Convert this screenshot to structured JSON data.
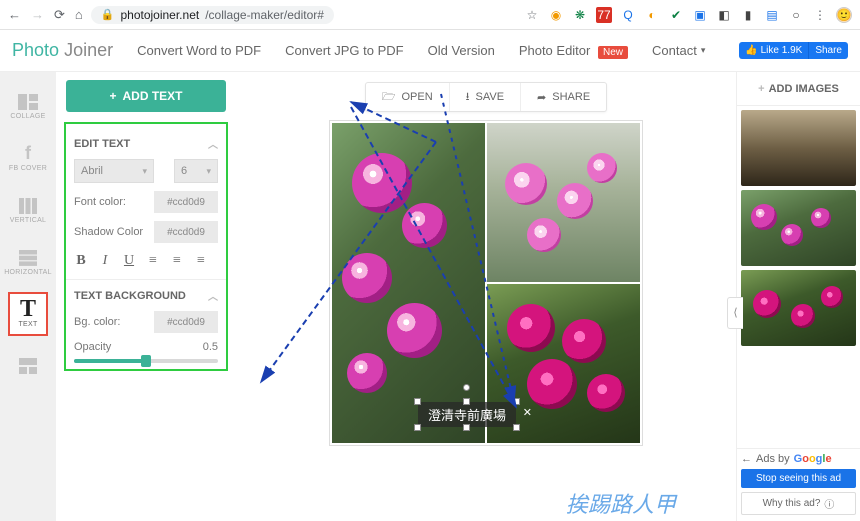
{
  "browser": {
    "url_host": "photojoiner.net",
    "url_path": "/collage-maker/editor#",
    "ext_gmail_count": "77"
  },
  "header": {
    "brand_a": "Photo",
    "brand_b": "Joiner",
    "nav": {
      "word_pdf": "Convert Word to PDF",
      "jpg_pdf": "Convert JPG to PDF",
      "old_version": "Old Version",
      "photo_editor": "Photo Editor",
      "new_badge": "New",
      "contact": "Contact"
    },
    "fb_like": "Like 1.9K",
    "fb_share": "Share"
  },
  "rail": {
    "collage": "COLLAGE",
    "fbcover": "FB COVER",
    "vertical": "VERTICAL",
    "horizontal": "HORIZONTAL",
    "text": "TEXT"
  },
  "panel": {
    "add_text": "ADD TEXT",
    "edit_text": "EDIT TEXT",
    "font_value": "Abril",
    "size_value": "6",
    "font_color_label": "Font color:",
    "font_color_value": "#ccd0d9",
    "shadow_label": "Shadow Color",
    "shadow_value": "#ccd0d9",
    "text_bg_title": "TEXT BACKGROUND",
    "bg_color_label": "Bg. color:",
    "bg_color_value": "#ccd0d9",
    "opacity_label": "Opacity",
    "opacity_value": "0.5"
  },
  "actions": {
    "open": "OPEN",
    "save": "SAVE",
    "share": "SHARE"
  },
  "canvas": {
    "overlay_text": "澄清寺前廣場",
    "watermark": "挨踢路人甲"
  },
  "right": {
    "add_images": "ADD IMAGES",
    "ads_by": "Ads by",
    "google": [
      "G",
      "o",
      "o",
      "g",
      "l",
      "e"
    ],
    "stop": "Stop seeing this ad",
    "why": "Why this ad?"
  }
}
